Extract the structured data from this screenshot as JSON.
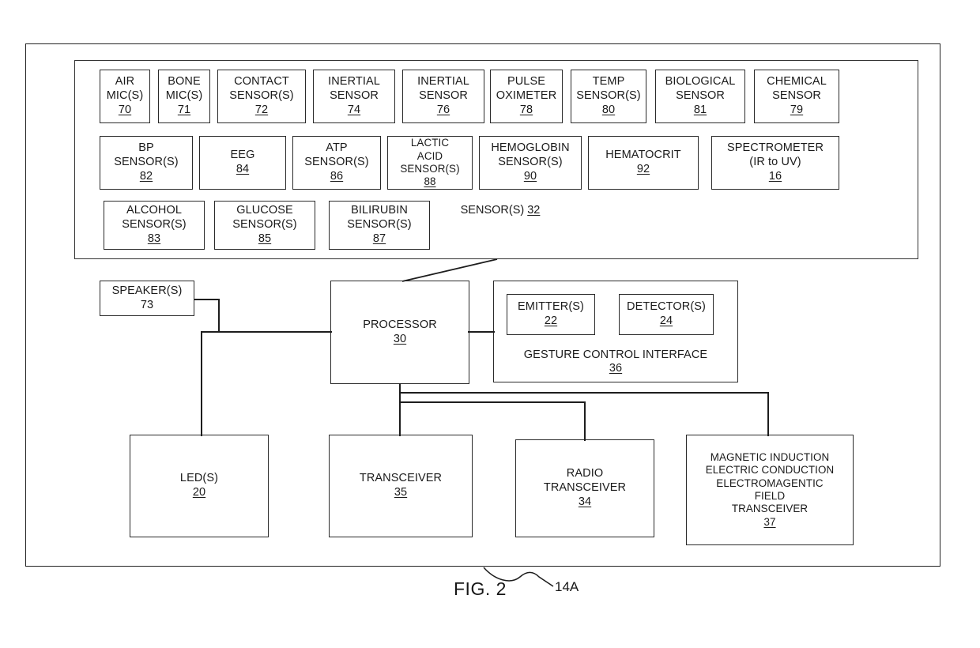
{
  "figure": {
    "caption": "FIG. 2",
    "callout": "14A"
  },
  "sensor_group": {
    "title": "SENSOR(S)",
    "ref": "32",
    "rows": [
      [
        {
          "lines": [
            "AIR",
            "MIC(S)"
          ],
          "ref": "70"
        },
        {
          "lines": [
            "BONE",
            "MIC(S)"
          ],
          "ref": "71"
        },
        {
          "lines": [
            "CONTACT",
            "SENSOR(S)"
          ],
          "ref": "72"
        },
        {
          "lines": [
            "INERTIAL",
            "SENSOR"
          ],
          "ref": "74"
        },
        {
          "lines": [
            "INERTIAL",
            "SENSOR"
          ],
          "ref": "76"
        },
        {
          "lines": [
            "PULSE",
            "OXIMETER"
          ],
          "ref": "78"
        },
        {
          "lines": [
            "TEMP",
            "SENSOR(S)"
          ],
          "ref": "80"
        },
        {
          "lines": [
            "BIOLOGICAL",
            "SENSOR"
          ],
          "ref": "81"
        },
        {
          "lines": [
            "CHEMICAL",
            "SENSOR"
          ],
          "ref": "79"
        }
      ],
      [
        {
          "lines": [
            "BP",
            "SENSOR(S)"
          ],
          "ref": "82"
        },
        {
          "lines": [
            "EEG"
          ],
          "ref": "84"
        },
        {
          "lines": [
            "ATP",
            "SENSOR(S)"
          ],
          "ref": "86"
        },
        {
          "lines": [
            "LACTIC",
            "ACID",
            "SENSOR(S)"
          ],
          "ref": "88"
        },
        {
          "lines": [
            "HEMOGLOBIN",
            "SENSOR(S)"
          ],
          "ref": "90"
        },
        {
          "lines": [
            "HEMATOCRIT"
          ],
          "ref": "92"
        },
        {
          "lines": [
            "SPECTROMETER",
            "(IR to UV)"
          ],
          "ref": "16"
        }
      ],
      [
        {
          "lines": [
            "ALCOHOL",
            "SENSOR(S)"
          ],
          "ref": "83"
        },
        {
          "lines": [
            "GLUCOSE",
            "SENSOR(S)"
          ],
          "ref": "85"
        },
        {
          "lines": [
            "BILIRUBIN",
            "SENSOR(S)"
          ],
          "ref": "87"
        }
      ]
    ]
  },
  "blocks": {
    "speaker": {
      "lines": [
        "SPEAKER(S)"
      ],
      "ref": "73",
      "ref_underlined": false
    },
    "processor": {
      "lines": [
        "PROCESSOR"
      ],
      "ref": "30",
      "ref_underlined": true
    },
    "emitter": {
      "lines": [
        "EMITTER(S)"
      ],
      "ref": "22",
      "ref_underlined": true
    },
    "detector": {
      "lines": [
        "DETECTOR(S)"
      ],
      "ref": "24",
      "ref_underlined": true
    },
    "gesture": {
      "lines": [
        "GESTURE CONTROL INTERFACE"
      ],
      "ref": "36",
      "ref_underlined": true
    },
    "led": {
      "lines": [
        "LED(S)"
      ],
      "ref": "20",
      "ref_underlined": true
    },
    "transceiver": {
      "lines": [
        "TRANSCEIVER"
      ],
      "ref": "35",
      "ref_underlined": true
    },
    "radio": {
      "lines": [
        "RADIO",
        "TRANSCEIVER"
      ],
      "ref": "34",
      "ref_underlined": true
    },
    "magnetic": {
      "lines": [
        "MAGNETIC INDUCTION",
        "ELECTRIC CONDUCTION",
        "ELECTROMAGENTIC",
        "FIELD",
        "TRANSCEIVER"
      ],
      "ref": "37",
      "ref_underlined": true
    }
  },
  "colors": {
    "line": "#1d1d1d",
    "box_border": "#2a2a2a",
    "text": "#1a1a1a",
    "background": "#ffffff"
  }
}
